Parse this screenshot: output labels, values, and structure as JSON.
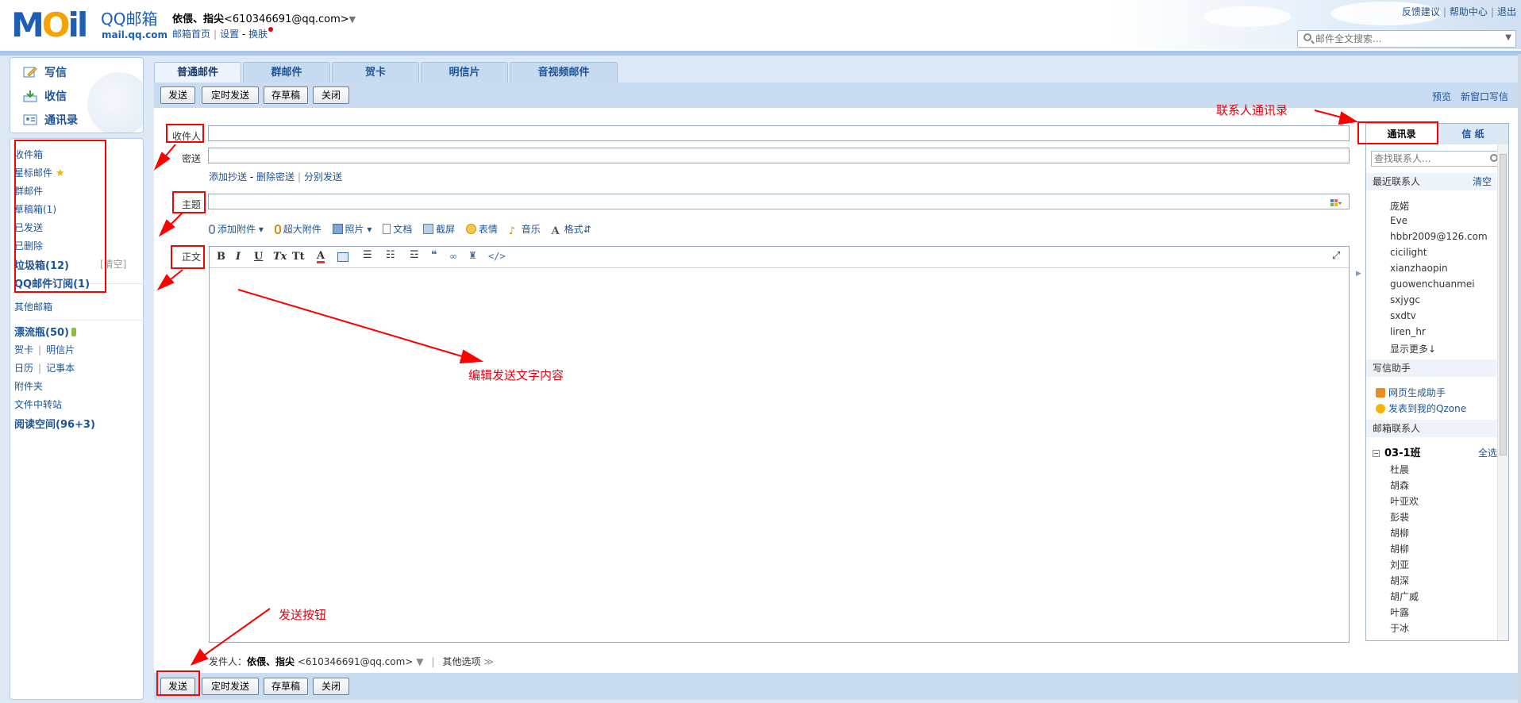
{
  "header": {
    "brand": "QQ邮箱",
    "domain": "mail.qq.com",
    "user_name": "依偎、指尖",
    "user_email": "<610346691@qq.com>",
    "links": {
      "home": "邮箱首页",
      "settings": "设置",
      "dash": "-",
      "skin": "换肤"
    },
    "top_links": [
      "反馈建议",
      "帮助中心",
      "退出"
    ],
    "search_placeholder": "邮件全文搜索..."
  },
  "left_nav": {
    "compose": "写信",
    "inbox": "收信",
    "contacts": "通讯录",
    "folders": [
      {
        "label": "收件箱"
      },
      {
        "label": "星标邮件"
      },
      {
        "label": "群邮件"
      },
      {
        "label": "草稿箱(1)"
      },
      {
        "label": "已发送"
      },
      {
        "label": "已删除"
      },
      {
        "label": "垃圾箱(12)"
      },
      {
        "label": "QQ邮件订阅(1)"
      }
    ],
    "clear": "[清空]",
    "other_mailbox": "其他邮箱",
    "drift_bottle": "漂流瓶(50)",
    "card": "贺卡",
    "postcard": "明信片",
    "calendar": "日历",
    "notes": "记事本",
    "attachments": "附件夹",
    "transfer": "文件中转站",
    "reading": "阅读空间(96+3)"
  },
  "tabs": [
    "普通邮件",
    "群邮件",
    "贺卡",
    "明信片",
    "音视频邮件"
  ],
  "toolbar": {
    "send": "发送",
    "scheduled": "定时发送",
    "draft": "存草稿",
    "close": "关闭",
    "preview": "预览",
    "new_window": "新窗口写信"
  },
  "form": {
    "to_label": "收件人",
    "bcc_label": "密送",
    "cc_links": [
      "添加抄送",
      "删除密送",
      "分别发送"
    ],
    "subject_label": "主题",
    "body_label": "正文",
    "attach_items": [
      "添加附件",
      "超大附件",
      "照片",
      "文档",
      "截屏",
      "表情",
      "音乐",
      "格式"
    ],
    "editor_buttons": [
      "B",
      "I",
      "U",
      "Tx",
      "Tt",
      "A",
      "</>"
    ]
  },
  "from_line": {
    "label": "发件人：",
    "name": "依偎、指尖",
    "email": "<610346691@qq.com>",
    "other": "其他选项"
  },
  "contacts_panel": {
    "tab_contacts": "通讯录",
    "tab_paper": "信  纸",
    "search_placeholder": "查找联系人...",
    "recent_title": "最近联系人",
    "clear": "清空",
    "recent": [
      "庞婼",
      "Eve",
      "hbbr2009@126.com",
      "cicilight",
      "xianzhaopin",
      "guowenchuanmei",
      "sxjygc",
      "sxdtv",
      "liren_hr",
      "显示更多↓"
    ],
    "helper_title": "写信助手",
    "helpers": [
      "网页生成助手",
      "发表到我的Qzone"
    ],
    "mail_contacts_title": "邮箱联系人",
    "group_name": "03-1班",
    "select_all": "全选",
    "group_members": [
      "杜晨",
      "胡森",
      "叶亚欢",
      "彭裴",
      "胡柳",
      "胡柳",
      "刘亚",
      "胡深",
      "胡广威",
      "叶露",
      "于冰"
    ]
  },
  "annotations": {
    "contacts_note": "联系人通讯录",
    "editor_note": "编辑发送文字内容",
    "send_note": "发送按钮"
  },
  "colors": {
    "annotation": "#ff0000",
    "link": "#1e5494",
    "toolbar": "#c9dcf2"
  }
}
